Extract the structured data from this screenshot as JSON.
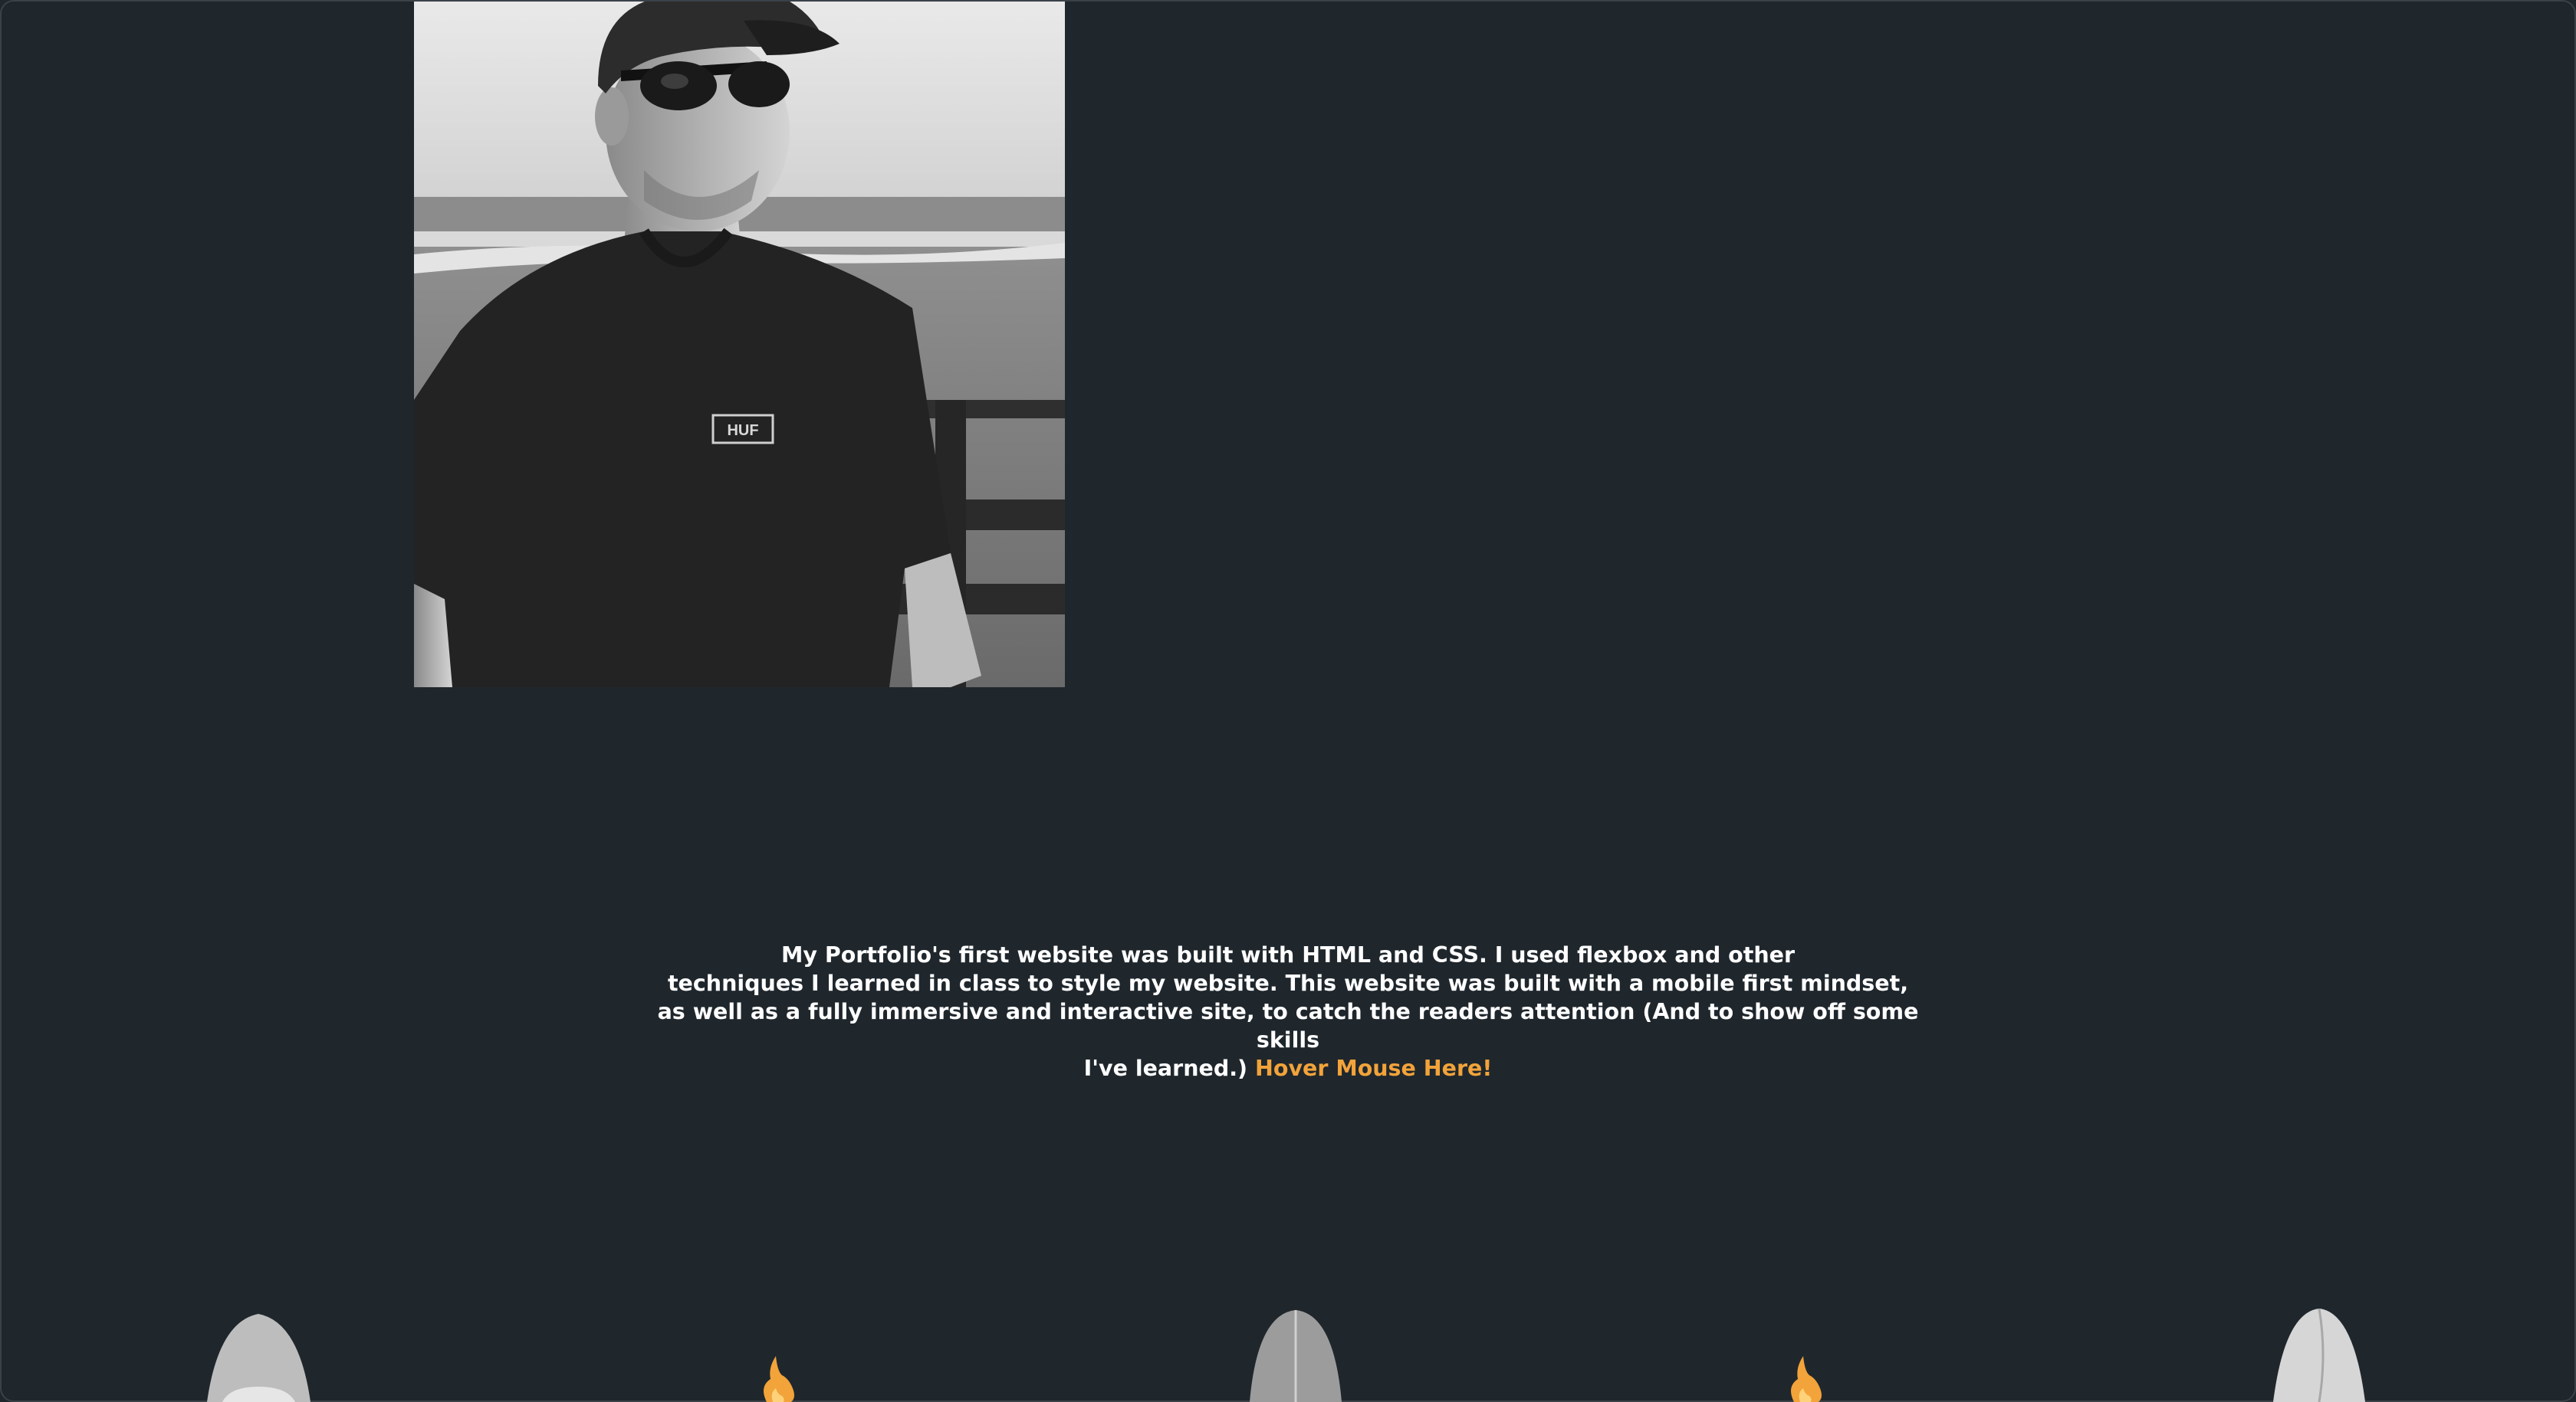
{
  "portrait": {
    "alt": "Black and white portrait photo",
    "shirt_logo": "HUF"
  },
  "description": {
    "line1": "My Portfolio's first website was built with HTML and CSS. I used flexbox and other",
    "line2": "techniques I learned in class to style my website. This website was built with a mobile first mindset,",
    "line3": "as well as a fully immersive and interactive site, to catch the readers attention (And to show off some skills",
    "line4": "I've learned.)",
    "hover_label": "Hover Mouse Here!"
  },
  "colors": {
    "background": "#1f272d",
    "accent": "#f2a33a",
    "text": "#ffffff"
  },
  "boards": [
    {
      "name": "surfboard-1",
      "color": "#bdbdbd"
    },
    {
      "name": "flame-1",
      "color": "#f2a33a"
    },
    {
      "name": "surfboard-2",
      "color": "#9c9c9c"
    },
    {
      "name": "flame-2",
      "color": "#f2a33a"
    },
    {
      "name": "surfboard-3",
      "color": "#d6d6d6"
    }
  ]
}
